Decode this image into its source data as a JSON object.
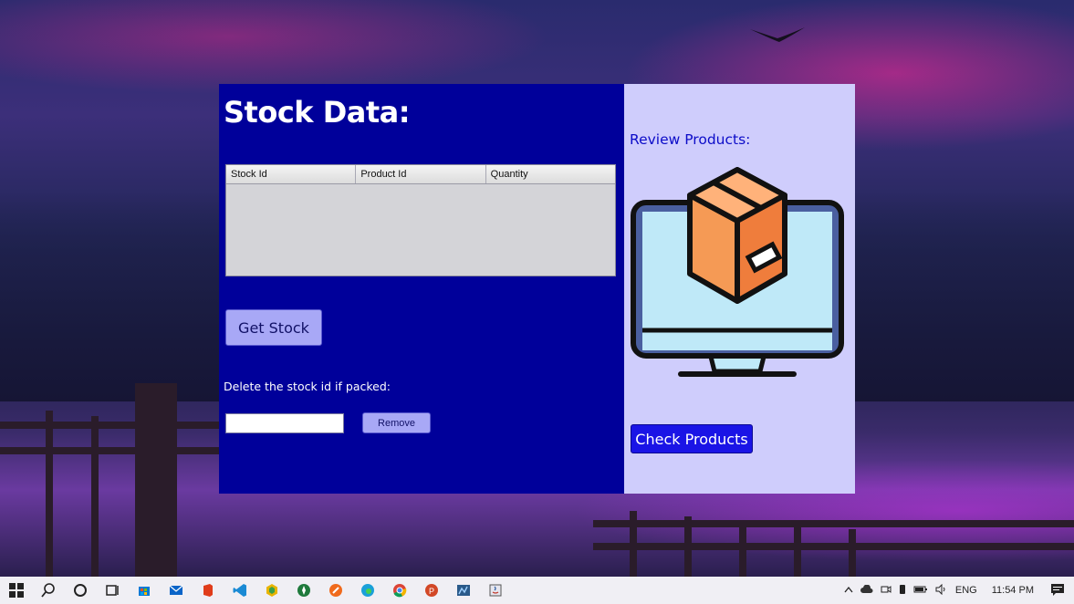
{
  "stock": {
    "title": "Stock Data:",
    "table": {
      "columns": [
        "Stock Id",
        "Product Id",
        "Quantity"
      ],
      "rows": []
    },
    "get_stock_label": "Get Stock",
    "delete_label": "Delete the stock id if packed:",
    "stock_id_input_value": "",
    "remove_label": "Remove",
    "colors": {
      "panel_bg": "#00009a",
      "button_bg": "#a8a8f6"
    }
  },
  "review": {
    "label": "Review Products:",
    "image_icon": "monitor-box-icon",
    "check_products_label": "Check Products",
    "colors": {
      "panel_bg": "#cfcdfc",
      "button_bg": "#1a14e6"
    }
  },
  "taskbar": {
    "icons": [
      "windows-start-icon",
      "search-icon",
      "cortana-icon",
      "task-view-icon",
      "store-icon",
      "mail-icon",
      "office-icon",
      "vscode-icon",
      "app-icon",
      "app-icon",
      "app-icon",
      "edge-icon",
      "chrome-icon",
      "powerpoint-icon",
      "app-icon",
      "java-icon"
    ],
    "tray": {
      "language": "ENG",
      "time": "11:54 PM"
    }
  }
}
